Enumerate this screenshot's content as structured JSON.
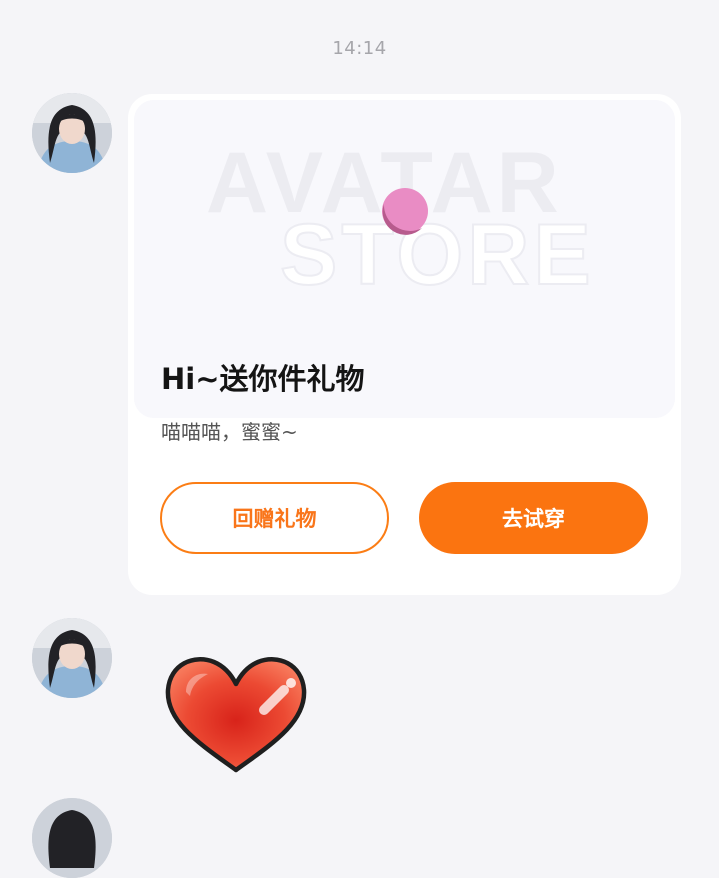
{
  "timestamp": "14:14",
  "messages": [
    {
      "type": "gift_card",
      "sender_avatar": "avatar",
      "banner": {
        "watermark_line1": "AVATAR",
        "watermark_line2": "STORE"
      },
      "title": "Hi~送你件礼物",
      "message": "喵喵喵，蜜蜜~",
      "buttons": {
        "return_gift": "回赠礼物",
        "try_on": "去试穿"
      }
    },
    {
      "type": "sticker",
      "sender_avatar": "avatar",
      "sticker_icon": "heart-sticker"
    }
  ],
  "colors": {
    "accent": "#fb7410",
    "page_background": "#f5f5f8",
    "card_background": "#ffffff",
    "heart_red": "#e8382a"
  }
}
